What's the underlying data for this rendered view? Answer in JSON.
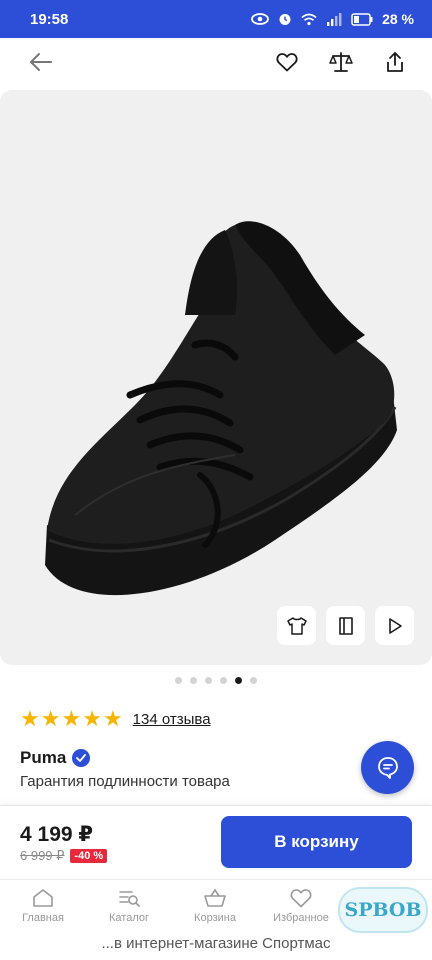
{
  "status_bar": {
    "time": "19:58",
    "battery": "28 %"
  },
  "top_nav": {
    "icons": [
      "arrow-left-icon",
      "heart-icon",
      "scales-icon",
      "share-icon"
    ]
  },
  "gallery": {
    "media_buttons": [
      "shirt-icon",
      "book-icon",
      "play-icon"
    ],
    "dots_count": 6,
    "active_dot": 4
  },
  "product": {
    "stars": 5,
    "rating_fraction": 1.0,
    "reviews": "134 отзыва",
    "brand": "Puma",
    "guarantee": "Гарантия подлинности товара"
  },
  "price": {
    "current": "4 199 ₽",
    "old": "6 999 ₽",
    "discount": "-40 %"
  },
  "cart_button": "В корзину",
  "bottom_nav": {
    "items": [
      {
        "label": "Главная",
        "icon": "home-icon"
      },
      {
        "label": "Каталог",
        "icon": "catalog-icon"
      },
      {
        "label": "Корзина",
        "icon": "basket-icon"
      },
      {
        "label": "Избранное",
        "icon": "heart-icon"
      },
      {
        "label": "",
        "icon": "profile-icon"
      }
    ]
  },
  "watermark": "SPBOB",
  "system_strip": "...в интернет-магазине Спортмас",
  "colors": {
    "primary": "#2d4fd8",
    "star": "#f7b500",
    "discount": "#e8283b"
  }
}
